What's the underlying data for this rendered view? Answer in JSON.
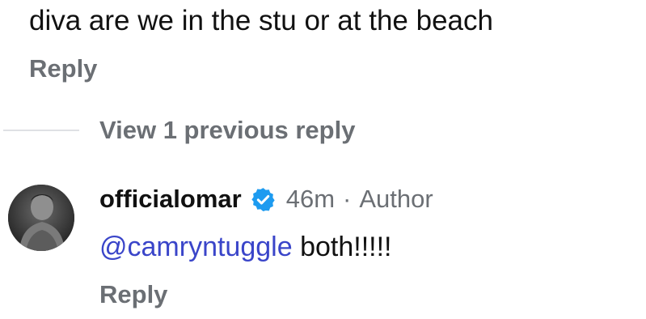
{
  "parent_comment": {
    "text": "diva are we in the stu or at the beach",
    "reply_label": "Reply"
  },
  "thread": {
    "view_replies_label": "View 1 previous reply"
  },
  "reply_comment": {
    "username": "officialomar",
    "verified_icon": "verified-badge-icon",
    "time": "46m",
    "separator": "·",
    "author_label": "Author",
    "mention": "@camryntuggle",
    "text": " both!!!!!",
    "reply_label": "Reply"
  },
  "colors": {
    "text": "#111111",
    "muted": "#6b6f74",
    "mention": "#3a45c9",
    "verified": "#1d9bf0"
  }
}
